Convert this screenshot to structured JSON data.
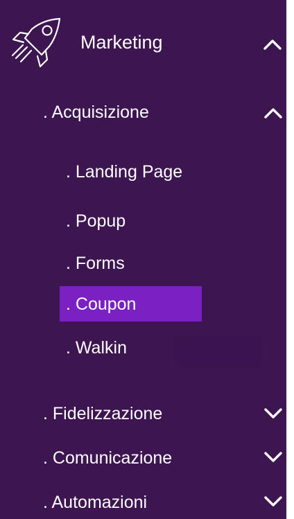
{
  "header": {
    "label": "Marketing",
    "icon": "rocket-icon",
    "state": "expanded"
  },
  "sections": [
    {
      "id": "acquisizione",
      "label": ". Acquisizione",
      "state": "expanded",
      "items": [
        {
          "label": ". Landing Page",
          "active": false
        },
        {
          "label": ". Popup",
          "active": false
        },
        {
          "label": ". Forms",
          "active": false
        },
        {
          "label": ". Coupon",
          "active": true
        },
        {
          "label": ". Walkin",
          "active": false
        }
      ]
    },
    {
      "id": "fidelizzazione",
      "label": ". Fidelizzazione",
      "state": "collapsed"
    },
    {
      "id": "comunicazione",
      "label": ". Comunicazione",
      "state": "collapsed"
    },
    {
      "id": "automazioni",
      "label": ". Automazioni",
      "state": "collapsed"
    }
  ],
  "colors": {
    "background": "#3d1551",
    "active_item": "#7b21c4",
    "text": "#ffffff"
  }
}
